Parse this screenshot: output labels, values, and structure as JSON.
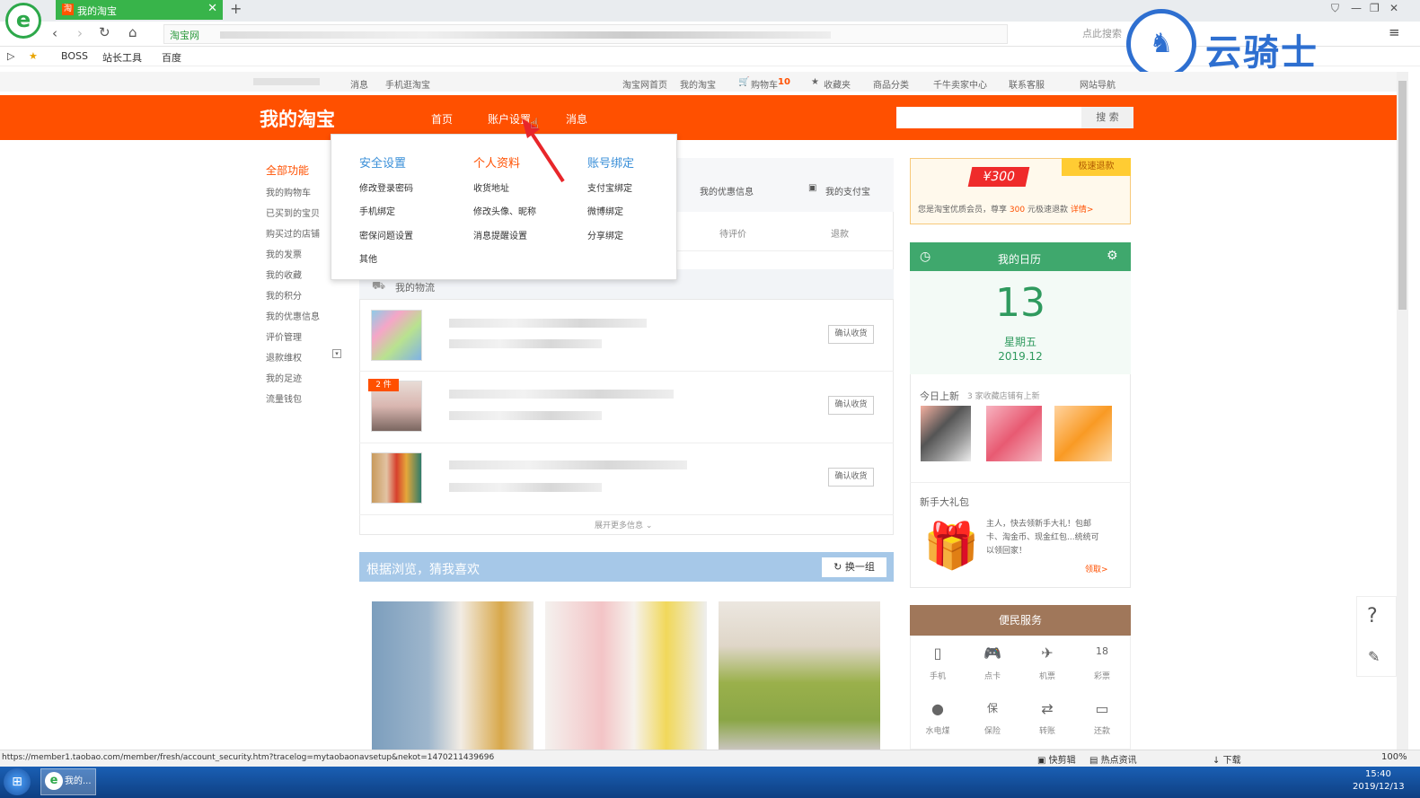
{
  "browser": {
    "tab_title": "我的淘宝",
    "site_badge": "淘宝网",
    "search_placeholder": "点此搜索",
    "favorites": [
      "BOSS",
      "站长工具",
      "百度"
    ]
  },
  "watermark": {
    "text": "云骑士"
  },
  "site_nav": {
    "left": [
      "消息",
      "手机逛淘宝"
    ],
    "right": [
      "淘宝网首页",
      "我的淘宝",
      "购物车",
      "收藏夹",
      "商品分类",
      "千牛卖家中心",
      "联系客服",
      "网站导航"
    ],
    "cart_count": "10"
  },
  "header": {
    "logo": "我的淘宝",
    "nav": [
      "首页",
      "账户设置",
      "消息"
    ],
    "search_button": "搜 索"
  },
  "sidebar": {
    "title": "全部功能",
    "items": [
      "我的购物车",
      "已买到的宝贝",
      "购买过的店铺",
      "我的发票",
      "我的收藏",
      "我的积分",
      "我的优惠信息",
      "评价管理",
      "退款维权",
      "我的足迹",
      "流量钱包"
    ]
  },
  "dropdown": {
    "columns": [
      {
        "title": "安全设置",
        "items": [
          "修改登录密码",
          "手机绑定",
          "密保问题设置",
          "其他"
        ]
      },
      {
        "title": "个人资料",
        "items": [
          "收货地址",
          "修改头像、昵称",
          "消息提醒设置"
        ]
      },
      {
        "title": "账号绑定",
        "items": [
          "支付宝绑定",
          "微博绑定",
          "分享绑定"
        ]
      }
    ]
  },
  "main": {
    "coupon_link": "我的优惠信息",
    "alipay_link": "我的支付宝",
    "tabs": [
      "待评价",
      "退款"
    ],
    "logistics_title": "我的物流",
    "orders": [
      {
        "badge": "",
        "button": "确认收货"
      },
      {
        "badge": "2 件",
        "button": "确认收货"
      },
      {
        "badge": "",
        "button": "确认收货"
      }
    ],
    "more": "展开更多信息",
    "recommend_title": "根据浏览，猜我喜欢",
    "refresh": "换一组"
  },
  "right": {
    "promo_amount": "¥300",
    "promo_tag": "极速退款",
    "promo_text_prefix": "您是淘宝优质会员，尊享",
    "promo_text_num": "300",
    "promo_text_suffix": "元极速退款",
    "promo_link": "详情>",
    "calendar_title": "我的日历",
    "day": "13",
    "weekday": "星期五",
    "month": "2019.12",
    "today_new": "今日上新",
    "today_new_count": "3",
    "today_new_note": "家收藏店铺有上新",
    "gift_title": "新手大礼包",
    "gift_text": "主人，快去领新手大礼！包邮卡、淘金币、现金红包...统统可以领回家！",
    "gift_link": "领取>",
    "services_title": "便民服务",
    "services": [
      {
        "icon": "phone-icon",
        "glyph": "▯",
        "label": "手机"
      },
      {
        "icon": "gamepad-icon",
        "glyph": "🎮",
        "label": "点卡"
      },
      {
        "icon": "plane-icon",
        "glyph": "✈",
        "label": "机票"
      },
      {
        "icon": "lottery-icon",
        "glyph": "18",
        "label": "彩票"
      },
      {
        "icon": "drop-icon",
        "glyph": "●",
        "label": "水电煤"
      },
      {
        "icon": "insurance-icon",
        "glyph": "保",
        "label": "保险"
      },
      {
        "icon": "transfer-icon",
        "glyph": "⇄",
        "label": "转账"
      },
      {
        "icon": "card-icon",
        "glyph": "▭",
        "label": "还款"
      }
    ]
  },
  "statusbar": {
    "url": "https://member1.taobao.com/member/fresh/account_security.htm?tracelog=mytaobaonavsetup&nekot=1470211439696",
    "items": [
      "快剪辑",
      "热点资讯",
      "下载"
    ],
    "zoom": "100%"
  },
  "taskbar": {
    "app": "我的...",
    "time": "15:40",
    "date": "2019/12/13"
  },
  "colors": {
    "brand": "#ff5000",
    "calendar": "#3fa86d",
    "services": "#a0775a"
  }
}
